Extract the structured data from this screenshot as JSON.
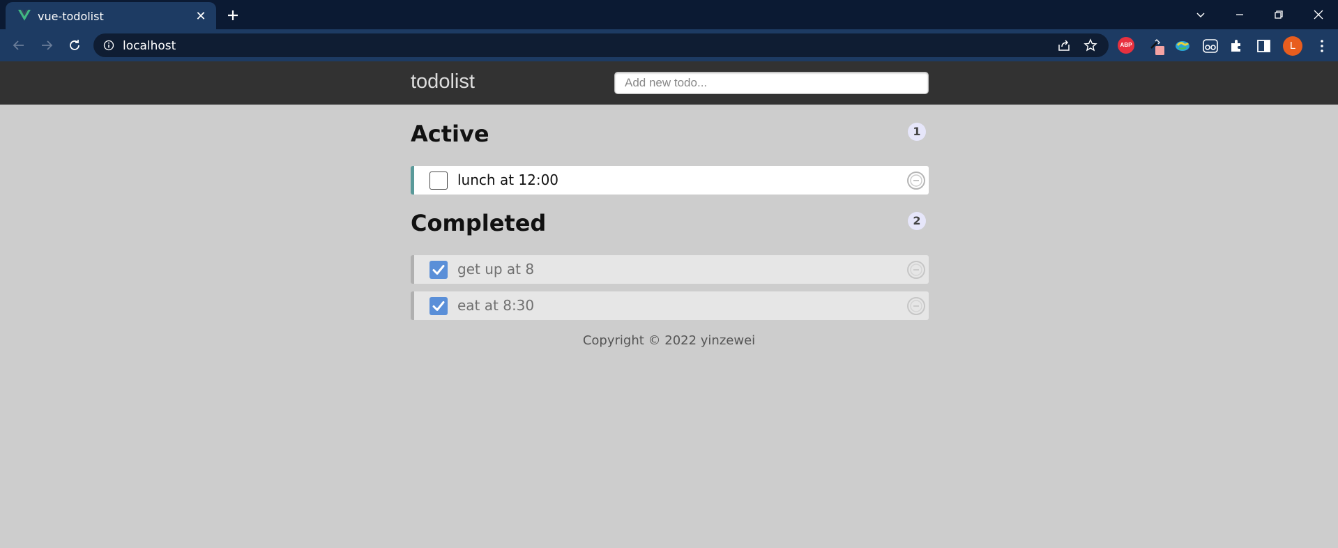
{
  "browser": {
    "tab": {
      "title": "vue-todolist",
      "favicon": "vue-logo-icon"
    },
    "address_bar": {
      "url": "localhost"
    },
    "avatar_initial": "L",
    "extensions": [
      "adblock-plus-icon",
      "eyedropper-icon",
      "earth-icon",
      "reader-icon",
      "puzzle-icon",
      "side-panel-icon"
    ],
    "colors": {
      "tabstrip": "#0b1a33",
      "toolbar": "#1d3b63",
      "omnibox": "#0f1d33",
      "avatar": "#e85d1e"
    }
  },
  "app": {
    "brand": "todolist",
    "add_placeholder": "Add new todo...",
    "sections": [
      {
        "title": "Active",
        "count": "1",
        "items": [
          {
            "text": "lunch at 12:00",
            "done": false
          }
        ]
      },
      {
        "title": "Completed",
        "count": "2",
        "items": [
          {
            "text": "get up at 8",
            "done": true
          },
          {
            "text": "eat at 8:30",
            "done": true
          }
        ]
      }
    ],
    "footer": "Copyright © 2022 yinzewei",
    "colors": {
      "header": "#323232",
      "page": "#cdcdcd",
      "active_border": "#5a9a9a",
      "done_border": "#b0b0b0",
      "checkbox_checked": "#5a8fd8",
      "badge": "#e6e6fa"
    }
  }
}
